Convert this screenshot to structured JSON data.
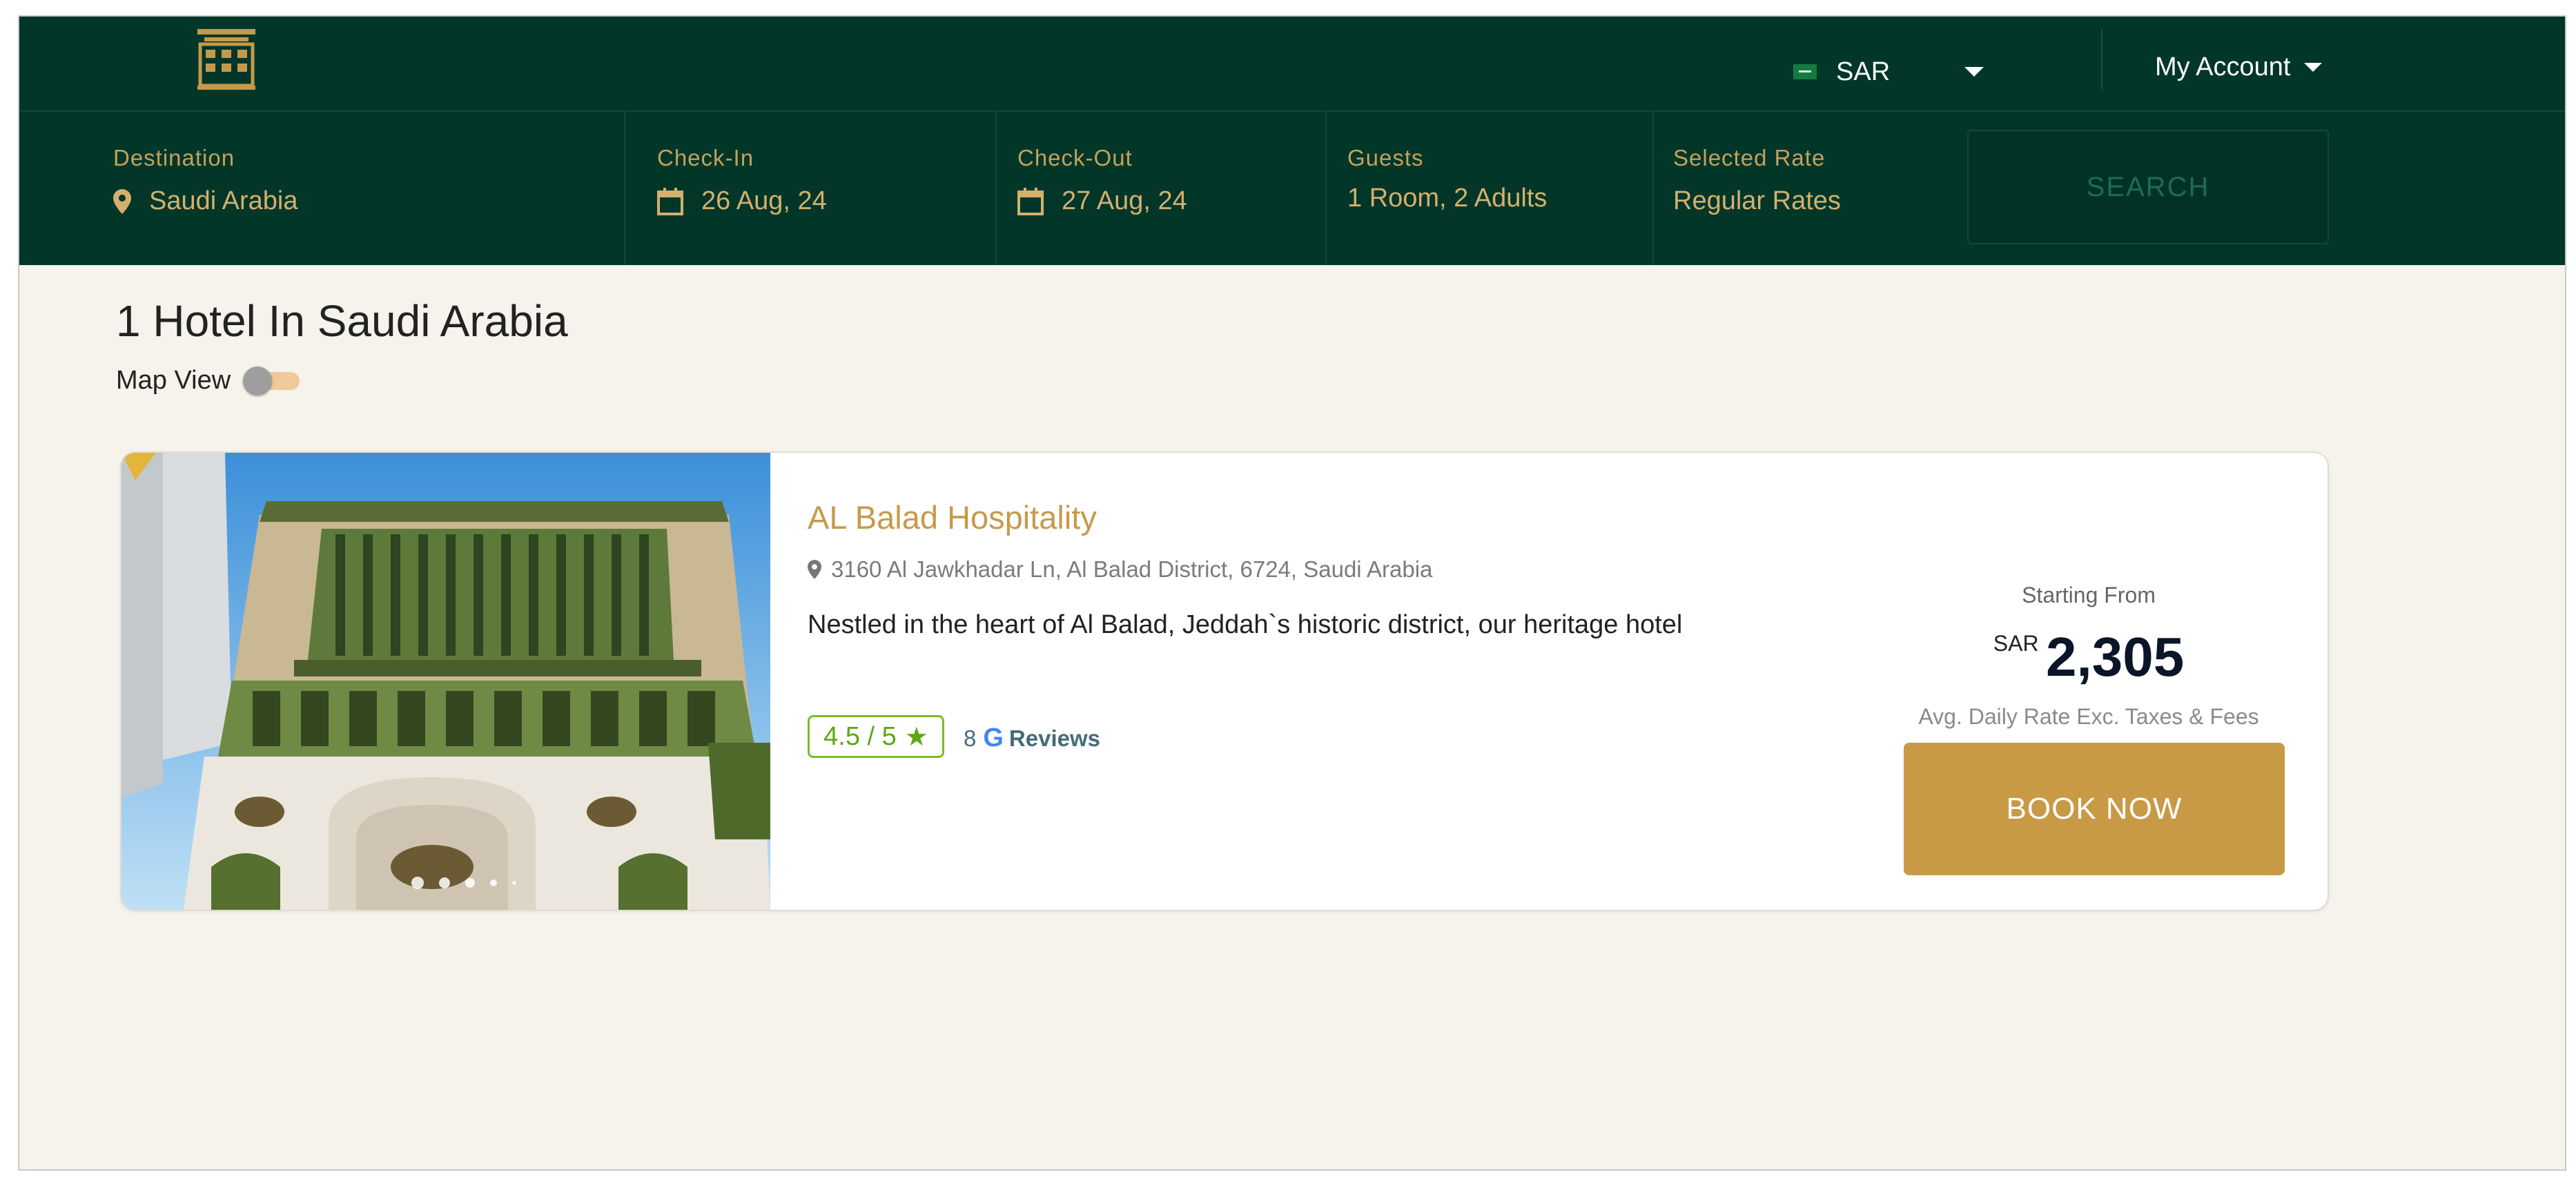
{
  "header": {
    "currency": "SAR",
    "account_label": "My Account"
  },
  "search": {
    "destination": {
      "label": "Destination",
      "value": "Saudi Arabia"
    },
    "check_in": {
      "label": "Check-In",
      "value": "26 Aug, 24"
    },
    "check_out": {
      "label": "Check-Out",
      "value": "27 Aug, 24"
    },
    "guests": {
      "label": "Guests",
      "value": "1 Room, 2 Adults"
    },
    "rate": {
      "label": "Selected Rate",
      "value": "Regular Rates"
    },
    "button_label": "SEARCH"
  },
  "results": {
    "title": "1 Hotel In Saudi Arabia",
    "map_view_label": "Map View",
    "map_view_on": false
  },
  "hotel": {
    "name": "AL Balad Hospitality",
    "address": "3160 Al Jawkhadar Ln, Al Balad District, 6724, Saudi Arabia",
    "description": "Nestled in the heart of Al Balad, Jeddah`s historic district, our heritage hotel",
    "rating": "4.5 / 5",
    "reviews_count": "8",
    "reviews_label": "Reviews",
    "starting_from_label": "Starting From",
    "price_currency": "SAR",
    "price": "2,305",
    "price_note": "Avg. Daily Rate Exc. Taxes & Fees",
    "book_label": "BOOK NOW",
    "image_count": 5,
    "active_image": 1
  },
  "colors": {
    "header_bg": "#013629",
    "gold": "#c89a45",
    "rating_green": "#7bbd26",
    "page_bg": "#f6f2ec"
  },
  "icons": {
    "logo": "building-logo-icon",
    "location": "map-pin-icon",
    "calendar": "calendar-icon",
    "star": "star-icon",
    "google": "google-icon"
  }
}
